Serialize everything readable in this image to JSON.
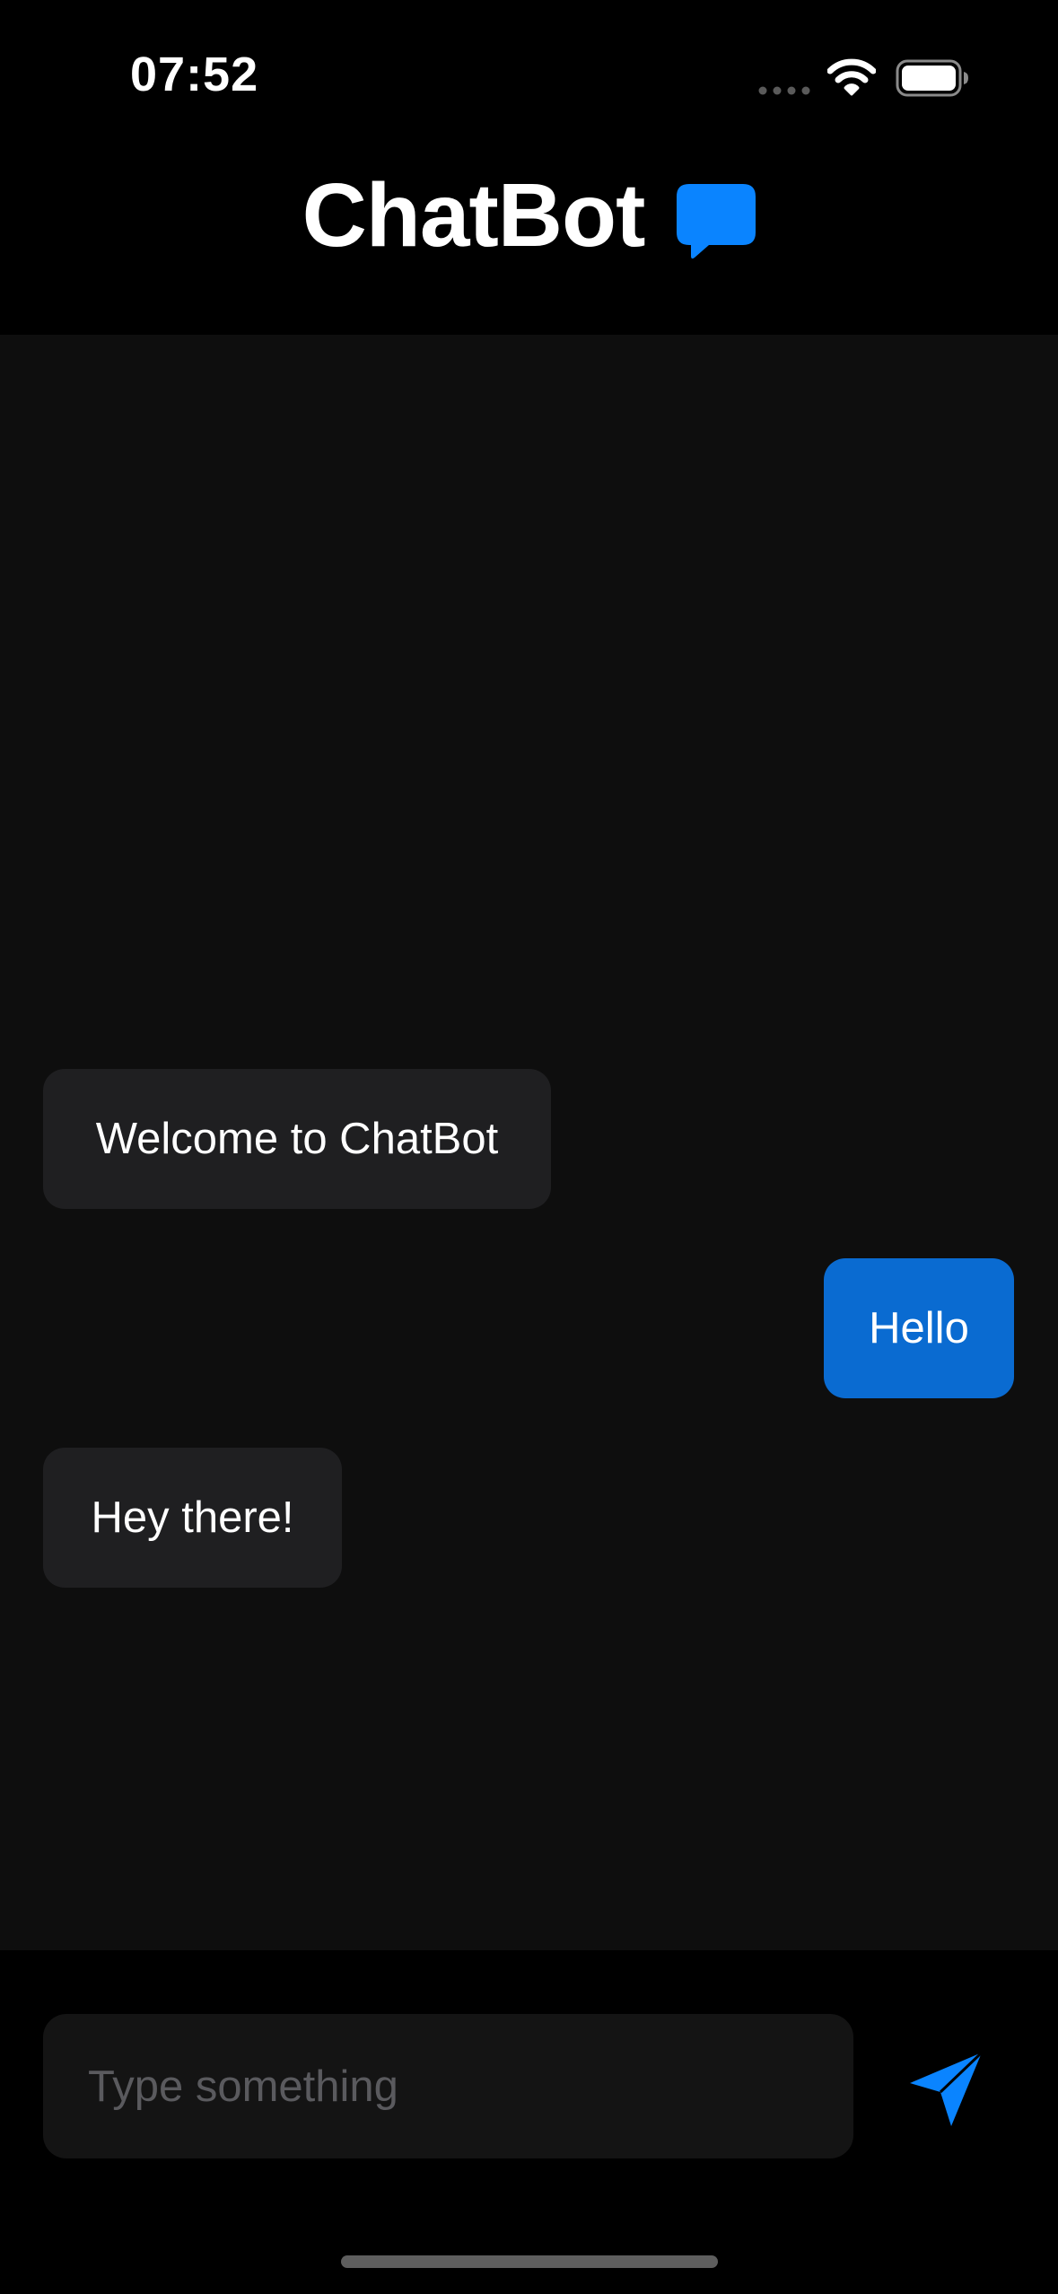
{
  "status_bar": {
    "time": "07:52",
    "icons": [
      "cellular-signal-icon",
      "wifi-icon",
      "battery-icon"
    ]
  },
  "header": {
    "title": "ChatBot",
    "icon": "chat-bubble-icon"
  },
  "messages": [
    {
      "sender": "bot",
      "text": "Welcome to ChatBot"
    },
    {
      "sender": "user",
      "text": "Hello"
    },
    {
      "sender": "bot",
      "text": "Hey there!"
    }
  ],
  "composer": {
    "placeholder": "Type something",
    "value": "",
    "send_icon": "paper-plane-icon"
  },
  "colors": {
    "accent": "#0a84ff",
    "user_bubble": "#0a6bd1",
    "bot_bubble": "#1f1f21",
    "chat_background": "#0e0e0e",
    "background": "#000000"
  }
}
